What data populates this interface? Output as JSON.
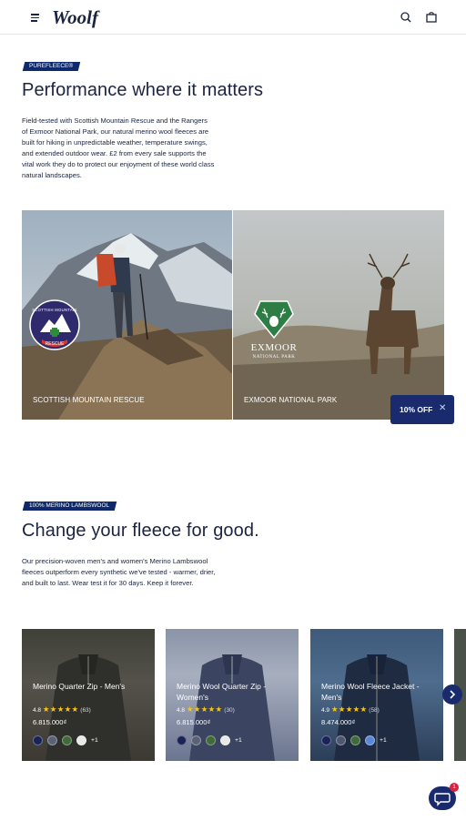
{
  "header": {
    "logo_text": "Woolf",
    "menu_icon": "hamburger-menu-icon",
    "search_icon": "search-icon",
    "bag_icon": "shopping-bag-icon"
  },
  "section1": {
    "tag": "PUREFLEECE®",
    "heading": "Performance where it matters",
    "body": "Field-tested with Scottish Mountain Rescue and the Rangers of Exmoor National Park, our natural merino wool fleeces are built for hiking in unpredictable weather, temperature swings, and extended outdoor wear. £2 from every sale supports the vital work they do to protect our enjoyment of these world class natural landscapes.",
    "partners": [
      {
        "label": "SCOTTISH MOUNTAIN RESCUE",
        "badge_text": "SCOTTISH MOUNTAIN RESCUE"
      },
      {
        "label": "EXMOOR NATIONAL PARK",
        "logo_title": "EXMOOR",
        "logo_sub": "NATIONAL PARK"
      }
    ]
  },
  "discount": {
    "label": "10% OFF",
    "close_icon": "close-icon"
  },
  "section2": {
    "tag": "100% MERINO LAMBSWOOL",
    "heading": "Change your fleece for good.",
    "body": "Our precision-woven men's and women's Merino Lambswool fleeces outperform every synthetic we've tested - warmer, drier, and built to last. Wear test it for 30 days. Keep it forever."
  },
  "products": [
    {
      "title": "Merino Quarter Zip - Men's",
      "rating": "4.8",
      "stars": "★★★★★",
      "count": "(63)",
      "price": "6.815.000₫",
      "swatches": [
        "#1a2357",
        "#5a6276",
        "#3f6b3a",
        "#e8e8e8"
      ],
      "more": "+1"
    },
    {
      "title": "Merino Wool Quarter Zip - Women's",
      "rating": "4.8",
      "stars": "★★★★★",
      "count": "(30)",
      "price": "6.815.000₫",
      "swatches": [
        "#1a2357",
        "#5a6276",
        "#3f6b3a",
        "#e8e8e8"
      ],
      "more": "+1"
    },
    {
      "title": "Merino Wool Fleece Jacket - Men's",
      "rating": "4.9",
      "stars": "★★★★★",
      "count": "(58)",
      "price": "8.474.000₫",
      "swatches": [
        "#1a2357",
        "#4e5670",
        "#3f6b3a",
        "#5b87d6"
      ],
      "more": "+1"
    }
  ],
  "carousel": {
    "next_icon": "chevron-right-icon"
  },
  "chat": {
    "icon": "chat-bubble-icon",
    "badge": "1"
  },
  "colors": {
    "navy": "#1a2b6d",
    "text": "#1b2440",
    "star": "#f5c518"
  }
}
